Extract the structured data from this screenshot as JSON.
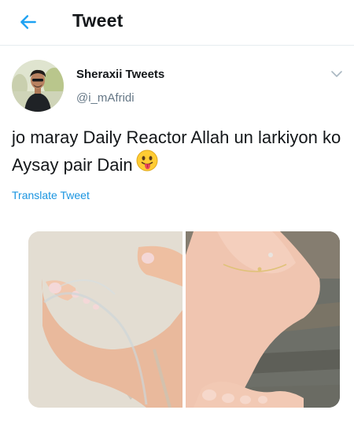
{
  "header": {
    "title": "Tweet",
    "back_icon": "arrow-left-icon",
    "accent_color": "#1da1f2"
  },
  "tweet": {
    "author": {
      "display_name": "Sheraxii Tweets",
      "handle": "@i_mAfridi"
    },
    "text": "jo maray Daily Reactor Allah un larkiyon ko Aysay pair Dain",
    "emoji": "face-with-tongue-emoji",
    "translate_label": "Translate Tweet",
    "media": [
      {
        "type": "photo",
        "name": "sandal-feet-photo"
      },
      {
        "type": "photo",
        "name": "anklet-feet-photo"
      }
    ]
  }
}
